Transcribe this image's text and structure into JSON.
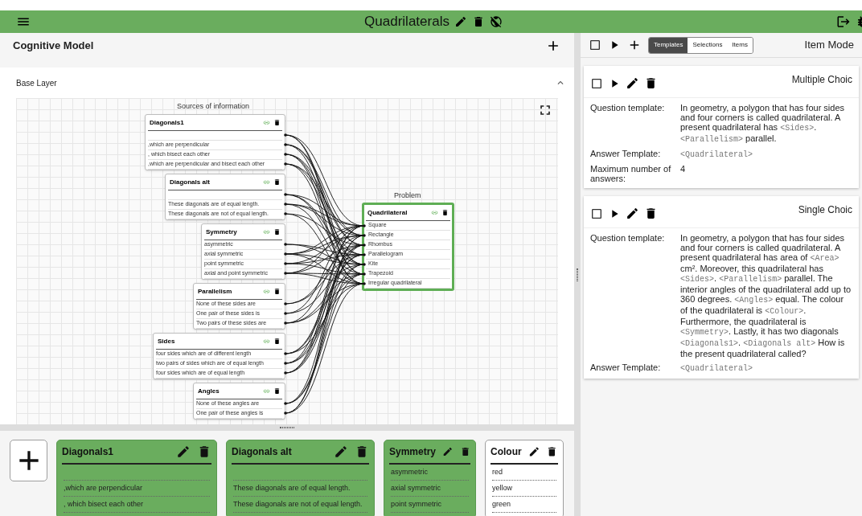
{
  "header": {
    "title": "Quadrilaterals"
  },
  "cognitive_model": {
    "title": "Cognitive Model",
    "layer": {
      "title": "Base Layer",
      "expanded": true
    },
    "canvas": {
      "sources_label": "Sources of information",
      "problem_label": "Problem",
      "sources": [
        {
          "title": "Diagonals1",
          "has_empty_option": true,
          "options": [
            ",which are perpendicular",
            ", which bisect each other",
            ",which are perpendicular and bisect each other"
          ]
        },
        {
          "title": "Diagonals alt",
          "has_empty_option": true,
          "options": [
            "These diagonals are of equal length.",
            "These diagonals are not of equal length."
          ]
        },
        {
          "title": "Symmetry",
          "has_empty_option": false,
          "options": [
            "asymmetric",
            "axial symmetric",
            "point symmetric",
            "axial and point symmetric"
          ]
        },
        {
          "title": "Parallelism",
          "has_empty_option": false,
          "options": [
            "None of these sides are",
            "One pair of these sides is",
            "Two pairs of these sides are"
          ]
        },
        {
          "title": "Sides",
          "has_empty_option": false,
          "options": [
            "four sides which are of different length",
            "two pairs of sides which are of equal length",
            "four sides which are of equal length"
          ]
        },
        {
          "title": "Angles",
          "has_empty_option": false,
          "options": [
            "None of these angles are",
            "One pair of these angles is"
          ]
        }
      ],
      "problem": {
        "title": "Quadrilateral",
        "options": [
          "Square",
          "Rectangle",
          "Rhombus",
          "Parallelogram",
          "Kite",
          "Trapezoid",
          "Irregular quadrilateral"
        ]
      }
    }
  },
  "attribute_cards": [
    {
      "title": "Diagonals1",
      "in_model": true,
      "has_empty_option": true,
      "options": [
        ",which are perpendicular",
        ", which bisect each other"
      ]
    },
    {
      "title": "Diagonals alt",
      "in_model": true,
      "has_empty_option": true,
      "options": [
        "These diagonals are of equal length.",
        "These diagonals are not of equal length."
      ]
    },
    {
      "title": "Symmetry",
      "in_model": true,
      "has_empty_option": false,
      "options": [
        "asymmetric",
        "axial symmetric",
        "point symmetric"
      ]
    },
    {
      "title": "Colour",
      "in_model": false,
      "has_empty_option": false,
      "options": [
        "red",
        "yellow",
        "green"
      ]
    }
  ],
  "item_model": {
    "title": "Item Mode",
    "all_checked": false,
    "tabs": [
      {
        "label": "Templates",
        "selected": true
      },
      {
        "label": "Selections",
        "selected": false
      },
      {
        "label": "Items",
        "selected": false
      }
    ],
    "templates": [
      {
        "type": "Multiple Choic",
        "checked": false,
        "fields": [
          {
            "label": "Question template:",
            "segments": [
              {
                "kind": "text",
                "text": "In geometry, a polygon that has four sides and four corners is called quadrilateral. A present quadrilateral has "
              },
              {
                "kind": "var",
                "text": "<Sides>"
              },
              {
                "kind": "text",
                "text": ". "
              },
              {
                "kind": "var",
                "text": "<Parallelism>"
              },
              {
                "kind": "text",
                "text": " parallel."
              }
            ]
          },
          {
            "label": "Answer Template:",
            "segments": [
              {
                "kind": "var",
                "text": "<Quadrilateral>"
              }
            ]
          },
          {
            "label": "Maximum number of answers:",
            "segments": [
              {
                "kind": "text",
                "text": "4"
              }
            ]
          }
        ]
      },
      {
        "type": "Single Choic",
        "checked": false,
        "fields": [
          {
            "label": "Question template:",
            "segments": [
              {
                "kind": "text",
                "text": "In geometry, a polygon that has four sides and four corners is called quadrilateral. A present quadrilateral has area of "
              },
              {
                "kind": "var",
                "text": "<Area>"
              },
              {
                "kind": "text",
                "text": " cm². Moreover, this quadrilateral has "
              },
              {
                "kind": "var",
                "text": "<Sides>"
              },
              {
                "kind": "text",
                "text": ". "
              },
              {
                "kind": "var",
                "text": "<Parallelism>"
              },
              {
                "kind": "text",
                "text": " parallel. The interior angles of the quadrilateral add up to 360 degrees. "
              },
              {
                "kind": "var",
                "text": "<Angles>"
              },
              {
                "kind": "text",
                "text": " equal. The colour of the quadrilateral is "
              },
              {
                "kind": "var",
                "text": "<Colour>"
              },
              {
                "kind": "text",
                "text": ". Furthermore, the quadrilateral is "
              },
              {
                "kind": "var",
                "text": "<Symmetry>"
              },
              {
                "kind": "text",
                "text": ". Lastly, it has two diagonals "
              },
              {
                "kind": "var",
                "text": "<Diagonals1>"
              },
              {
                "kind": "text",
                "text": ". "
              },
              {
                "kind": "var",
                "text": "<Diagonals alt>"
              },
              {
                "kind": "text",
                "text": " How is the present quadrilateral called?"
              }
            ]
          },
          {
            "label": "Answer Template:",
            "segments": [
              {
                "kind": "var",
                "text": "<Quadrilateral>"
              }
            ]
          }
        ]
      }
    ]
  }
}
